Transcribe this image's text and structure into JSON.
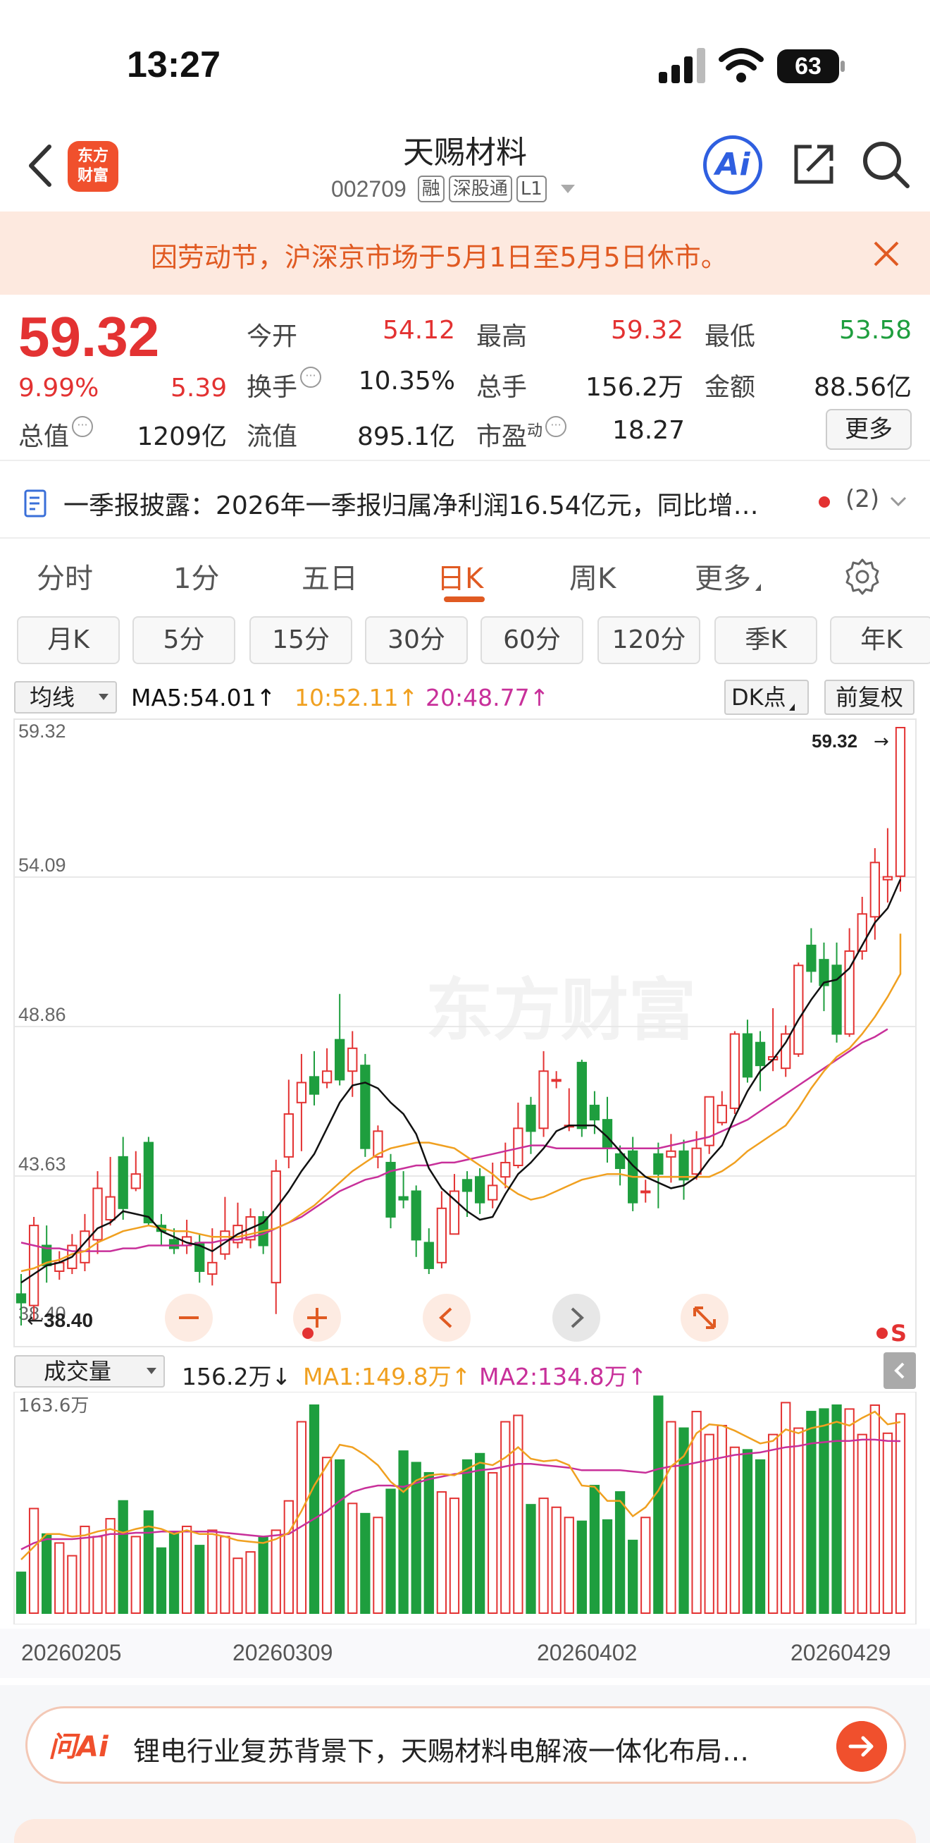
{
  "status": {
    "time": "13:27",
    "battery": "63"
  },
  "header": {
    "back_label": "",
    "logo_text": "东方\n财富",
    "name": "天赐材料",
    "code": "002709",
    "tags": [
      "融",
      "深股通",
      "L1"
    ],
    "ai_label": "Ai"
  },
  "notice": {
    "text": "因劳动节，沪深京市场于5月1日至5月5日休市。"
  },
  "quote": {
    "price": "59.32",
    "change_pct": "9.99%",
    "change_amt": "5.39",
    "rows": [
      [
        {
          "label": "今开",
          "value": "54.12",
          "color": "red"
        },
        {
          "label": "最高",
          "value": "59.32",
          "color": "red"
        },
        {
          "label": "最低",
          "value": "53.58",
          "color": "green"
        }
      ],
      [
        {
          "label": "换手",
          "value": "10.35%",
          "color": "dark"
        },
        {
          "label": "总手",
          "value": "156.2万",
          "color": "dark"
        },
        {
          "label": "金额",
          "value": "88.56亿",
          "color": "dark"
        }
      ],
      [
        {
          "label": "流值",
          "value": "895.1亿",
          "color": "dark"
        },
        {
          "label": "市盈",
          "value": "18.27",
          "color": "dark"
        }
      ]
    ],
    "total_value_label": "总值",
    "total_value": "1209亿",
    "pe_sup": "动",
    "more": "更多"
  },
  "news": {
    "text": "一季报披露：2026年一季报归属净利润16.54亿元，同比增…",
    "count": "(2)"
  },
  "period_tabs": [
    "分时",
    "1分",
    "五日",
    "日K",
    "周K",
    "更多"
  ],
  "active_period": "日K",
  "sub_tabs": [
    "月K",
    "5分",
    "15分",
    "30分",
    "60分",
    "120分",
    "季K",
    "年K"
  ],
  "ma_bar": {
    "selector": "均线",
    "ma5": "MA5:54.01↑",
    "ma10": "10:52.11↑",
    "ma20": "20:48.77↑",
    "dk": "DK点",
    "fq": "前复权"
  },
  "volume_bar": {
    "selector": "成交量",
    "vol": "156.2万↓",
    "ma1": "MA1:149.8万↑",
    "ma2": "MA2:134.8万↑",
    "max_label": "163.6万"
  },
  "dates": [
    "20260205",
    "20260309",
    "20260402",
    "20260429"
  ],
  "ai_prompt": {
    "logo": "问Ai",
    "text": "锂电行业复苏背景下，天赐材料电解液一体化布局…"
  },
  "colors": {
    "up": "#e33232",
    "down": "#1e9e3e",
    "ma5": "#111111",
    "ma10": "#f0a020",
    "ma20": "#c8309a",
    "accent": "#e05a22"
  },
  "chart_data": {
    "type": "candlestick",
    "y_ticks": [
      "59.32",
      "54.09",
      "48.86",
      "43.63",
      "38.40"
    ],
    "ylim": [
      38.4,
      59.32
    ],
    "high_marker": "59.32",
    "low_marker": "38.40",
    "x_labels": [
      "20260205",
      "20260309",
      "20260402",
      "20260429"
    ],
    "candles": [
      [
        39.5,
        39.2,
        40.2,
        38.4
      ],
      [
        39.1,
        41.9,
        42.2,
        38.6
      ],
      [
        41.2,
        40.5,
        41.9,
        39.9
      ],
      [
        40.3,
        40.6,
        41.0,
        40.0
      ],
      [
        40.4,
        41.2,
        41.6,
        40.2
      ],
      [
        40.6,
        41.7,
        42.3,
        40.3
      ],
      [
        41.4,
        43.2,
        43.8,
        40.9
      ],
      [
        42.1,
        42.9,
        44.3,
        41.9
      ],
      [
        44.3,
        42.5,
        45.0,
        42.1
      ],
      [
        43.2,
        43.7,
        44.5,
        43.1
      ],
      [
        44.8,
        42.0,
        45.0,
        41.9
      ],
      [
        41.9,
        41.7,
        42.3,
        41.2
      ],
      [
        41.4,
        41.1,
        41.8,
        40.9
      ],
      [
        41.2,
        41.5,
        42.1,
        40.9
      ],
      [
        41.3,
        40.3,
        41.6,
        39.9
      ],
      [
        40.2,
        40.6,
        41.8,
        39.8
      ],
      [
        40.9,
        41.7,
        42.9,
        40.7
      ],
      [
        41.3,
        41.9,
        42.7,
        41.1
      ],
      [
        41.4,
        42.2,
        42.5,
        41.1
      ],
      [
        42.2,
        41.2,
        42.4,
        40.9
      ],
      [
        39.9,
        43.8,
        44.2,
        38.8
      ],
      [
        44.3,
        45.8,
        47.0,
        43.9
      ],
      [
        46.2,
        46.9,
        47.9,
        44.5
      ],
      [
        47.1,
        46.5,
        48.0,
        46.1
      ],
      [
        46.9,
        47.3,
        48.1,
        46.7
      ],
      [
        48.4,
        47.0,
        50.0,
        46.8
      ],
      [
        47.3,
        48.1,
        48.7,
        46.4
      ],
      [
        47.5,
        44.6,
        47.9,
        44.3
      ],
      [
        44.3,
        45.2,
        45.4,
        43.9
      ],
      [
        44.1,
        42.2,
        44.4,
        41.8
      ],
      [
        42.9,
        42.8,
        43.8,
        42.5
      ],
      [
        43.1,
        41.4,
        43.3,
        40.8
      ],
      [
        41.3,
        40.4,
        41.8,
        40.2
      ],
      [
        40.6,
        42.5,
        43.1,
        40.4
      ],
      [
        41.6,
        43.1,
        43.7,
        41.6
      ],
      [
        43.5,
        43.1,
        43.8,
        42.2
      ],
      [
        43.6,
        42.7,
        43.9,
        42.3
      ],
      [
        42.8,
        43.3,
        44.1,
        42.5
      ],
      [
        43.6,
        44.1,
        44.8,
        43.2
      ],
      [
        44.0,
        45.3,
        46.2,
        43.9
      ],
      [
        46.1,
        45.2,
        46.4,
        44.4
      ],
      [
        45.3,
        47.3,
        48.0,
        45.0
      ],
      [
        47.0,
        47.0,
        47.3,
        46.7
      ],
      [
        45.4,
        45.4,
        46.7,
        45.2
      ],
      [
        47.6,
        45.3,
        47.7,
        45.0
      ],
      [
        46.1,
        45.6,
        46.6,
        45.1
      ],
      [
        45.6,
        44.6,
        46.4,
        44.1
      ],
      [
        44.4,
        43.9,
        44.7,
        43.3
      ],
      [
        44.5,
        42.7,
        45.0,
        42.4
      ],
      [
        43.1,
        43.1,
        43.5,
        42.7
      ],
      [
        44.4,
        43.7,
        44.8,
        42.5
      ],
      [
        44.3,
        44.5,
        45.1,
        43.4
      ],
      [
        44.5,
        43.5,
        44.9,
        42.8
      ],
      [
        43.7,
        44.6,
        45.2,
        43.5
      ],
      [
        44.7,
        46.4,
        46.4,
        44.4
      ],
      [
        45.5,
        46.1,
        46.6,
        45.4
      ],
      [
        46.0,
        48.6,
        48.7,
        45.8
      ],
      [
        48.6,
        47.1,
        49.1,
        46.9
      ],
      [
        48.3,
        47.5,
        48.7,
        46.6
      ],
      [
        47.7,
        47.8,
        49.5,
        47.3
      ],
      [
        47.4,
        48.6,
        48.9,
        47.1
      ],
      [
        47.9,
        51.0,
        51.1,
        47.8
      ],
      [
        51.7,
        50.8,
        52.3,
        50.4
      ],
      [
        51.2,
        50.3,
        51.8,
        49.4
      ],
      [
        51.0,
        48.6,
        51.8,
        48.3
      ],
      [
        48.6,
        51.5,
        52.3,
        48.5
      ],
      [
        51.5,
        52.8,
        53.4,
        51.2
      ],
      [
        52.7,
        54.6,
        55.1,
        51.9
      ],
      [
        54.0,
        54.1,
        55.8,
        53.2
      ],
      [
        54.12,
        59.32,
        59.32,
        53.58
      ]
    ],
    "ma5": [
      39.9,
      40.2,
      40.5,
      40.6,
      40.8,
      41.3,
      41.8,
      42.0,
      42.4,
      42.3,
      42.2,
      41.7,
      41.5,
      41.3,
      41.2,
      41.0,
      41.3,
      41.6,
      41.8,
      42.0,
      42.5,
      43.1,
      43.8,
      44.4,
      45.3,
      46.2,
      46.8,
      46.9,
      46.7,
      46.2,
      45.8,
      45.1,
      43.9,
      43.2,
      42.8,
      42.4,
      42.1,
      42.2,
      43.0,
      43.7,
      44.1,
      44.6,
      45.2,
      45.4,
      45.4,
      45.4,
      45.0,
      44.5,
      44.0,
      43.6,
      43.4,
      43.2,
      43.3,
      43.6,
      44.2,
      44.7,
      45.7,
      46.6,
      47.3,
      47.7,
      48.3,
      49.1,
      49.8,
      50.4,
      50.5,
      50.9,
      51.7,
      52.5,
      53.0,
      54.01
    ],
    "ma10": [
      40.3,
      40.4,
      40.6,
      40.7,
      40.9,
      41.0,
      41.3,
      41.5,
      41.7,
      41.8,
      41.9,
      41.8,
      41.7,
      41.7,
      41.6,
      41.5,
      41.5,
      41.5,
      41.6,
      41.7,
      41.8,
      42.0,
      42.3,
      42.6,
      43.0,
      43.4,
      43.8,
      44.1,
      44.4,
      44.6,
      44.7,
      44.8,
      44.8,
      44.7,
      44.6,
      44.3,
      44.0,
      43.7,
      43.3,
      43.0,
      42.8,
      42.9,
      43.1,
      43.3,
      43.5,
      43.6,
      43.7,
      43.7,
      43.6,
      43.6,
      43.6,
      43.6,
      43.6,
      43.6,
      43.6,
      43.8,
      44.1,
      44.5,
      44.8,
      45.1,
      45.4,
      46.0,
      46.7,
      47.3,
      47.8,
      48.1,
      48.6,
      49.2,
      49.9,
      50.7,
      52.11
    ],
    "ma20": [
      41.3,
      41.2,
      41.1,
      41.1,
      41.0,
      41.0,
      41.0,
      41.0,
      41.1,
      41.1,
      41.2,
      41.2,
      41.2,
      41.2,
      41.3,
      41.3,
      41.4,
      41.4,
      41.5,
      41.6,
      41.8,
      42.0,
      42.2,
      42.5,
      42.8,
      43.1,
      43.3,
      43.5,
      43.6,
      43.8,
      43.9,
      44.0,
      44.0,
      44.1,
      44.1,
      44.2,
      44.3,
      44.4,
      44.5,
      44.6,
      44.7,
      44.7,
      44.6,
      44.6,
      44.6,
      44.6,
      44.6,
      44.6,
      44.6,
      44.6,
      44.6,
      44.7,
      44.8,
      44.9,
      45.0,
      45.2,
      45.4,
      45.6,
      45.9,
      46.2,
      46.5,
      46.8,
      47.1,
      47.4,
      47.7,
      48.0,
      48.3,
      48.5,
      48.77
    ],
    "volume": {
      "max": 163.6,
      "values": [
        32,
        82,
        62,
        55,
        45,
        68,
        60,
        74,
        88,
        60,
        80,
        51,
        63,
        68,
        53,
        65,
        60,
        43,
        48,
        60,
        65,
        88,
        150,
        163,
        122,
        120,
        86,
        78,
        75,
        97,
        127,
        118,
        110,
        95,
        90,
        120,
        125,
        110,
        150,
        155,
        85,
        90,
        83,
        75,
        72,
        100,
        73,
        95,
        57,
        75,
        170,
        150,
        145,
        158,
        140,
        147,
        130,
        128,
        120,
        140,
        165,
        145,
        158,
        160,
        163,
        160,
        140,
        163,
        141,
        156.2
      ],
      "ma1": [
        42,
        52,
        62,
        62,
        60,
        61,
        64,
        66,
        63,
        66,
        68,
        66,
        62,
        65,
        62,
        62,
        60,
        57,
        56,
        55,
        58,
        63,
        80,
        100,
        116,
        132,
        130,
        124,
        116,
        103,
        95,
        104,
        108,
        109,
        108,
        113,
        118,
        116,
        122,
        130,
        121,
        119,
        120,
        116,
        100,
        99,
        88,
        88,
        76,
        83,
        96,
        115,
        123,
        141,
        148,
        147,
        143,
        138,
        133,
        135,
        144,
        141,
        145,
        147,
        150,
        147,
        153,
        158,
        148,
        149.8
      ],
      "ma2": [
        50,
        55,
        58,
        58,
        58,
        59,
        60,
        62,
        62,
        63,
        63,
        64,
        64,
        64,
        64,
        64,
        63,
        62,
        61,
        60,
        61,
        62,
        68,
        74,
        80,
        88,
        95,
        98,
        100,
        100,
        99,
        102,
        105,
        107,
        109,
        110,
        112,
        113,
        115,
        117,
        117,
        116,
        115,
        114,
        112,
        112,
        112,
        112,
        111,
        110,
        113,
        115,
        116,
        118,
        120,
        122,
        124,
        125,
        126,
        128,
        130,
        131,
        133,
        134,
        135,
        135,
        136,
        136,
        135,
        134.8
      ]
    }
  }
}
